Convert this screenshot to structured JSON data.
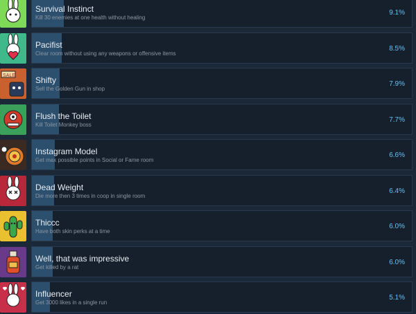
{
  "achievements": [
    {
      "name": "Survival Instinct",
      "description": "Kill 30 enemies at one health without healing",
      "percent_label": "9.1%",
      "percent": 9.1,
      "icon": "bunny-icon",
      "icon_color": "#7ed957"
    },
    {
      "name": "Pacifist",
      "description": "Clear room without using any weapons or offensive items",
      "percent_label": "8.5%",
      "percent": 8.5,
      "icon": "bunny-heart-icon",
      "icon_color": "#3fb98a"
    },
    {
      "name": "Shifty",
      "description": "Sell the Golden Gun in shop",
      "percent_label": "7.9%",
      "percent": 7.9,
      "icon": "shop-sale-icon",
      "icon_color": "#c9602e"
    },
    {
      "name": "Flush the Toilet",
      "description": "Kill Toilet Monkey boss",
      "percent_label": "7.7%",
      "percent": 7.7,
      "icon": "toilet-monkey-icon",
      "icon_color": "#3aa05a"
    },
    {
      "name": "Instagram Model",
      "description": "Get max possible points in Social or Fame room",
      "percent_label": "6.6%",
      "percent": 6.6,
      "icon": "camera-target-icon",
      "icon_color": "#e07a2a"
    },
    {
      "name": "Dead Weight",
      "description": "Die more then 3 times in coop in single room",
      "percent_label": "6.4%",
      "percent": 6.4,
      "icon": "bunny-dead-icon",
      "icon_color": "#b8283a"
    },
    {
      "name": "Thiccc",
      "description": "Have both skin perks at a time",
      "percent_label": "6.0%",
      "percent": 6.0,
      "icon": "cactus-icon",
      "icon_color": "#e8c030"
    },
    {
      "name": "Well, that was impressive",
      "description": "Get killed by a rat",
      "percent_label": "6.0%",
      "percent": 6.0,
      "icon": "rat-bottle-icon",
      "icon_color": "#6a3a8a"
    },
    {
      "name": "Influencer",
      "description": "Get 3000 likes in a single run",
      "percent_label": "5.1%",
      "percent": 5.1,
      "icon": "bunny-hearts-icon",
      "icon_color": "#c8304a"
    }
  ],
  "colors": {
    "background": "#1b2838",
    "panel": "#16202d",
    "progress_fill": "#2c4f6e",
    "percent_text": "#66c0f4"
  }
}
